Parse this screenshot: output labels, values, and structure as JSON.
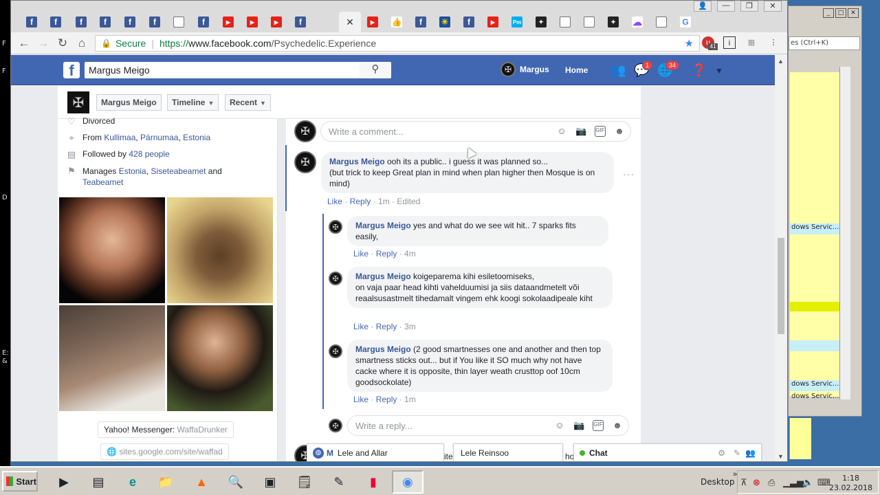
{
  "desktop": {
    "left_chars": [
      "F",
      "F",
      "D",
      "E:",
      "&"
    ]
  },
  "browser": {
    "url_secure_label": "Secure",
    "url_scheme": "https://",
    "url_host": "www.facebook.com",
    "url_path": "/Psychedelic.Experience",
    "ext_badge": "41"
  },
  "bgwin": {
    "search_placeholder": "es (Ctrl+K)",
    "rows": [
      "dows Servic...",
      "dows Servic...",
      "dows Servic..."
    ]
  },
  "fb": {
    "search_value": "Margus Meigo",
    "user_name": "Margus",
    "home_label": "Home",
    "messenger_badge": "1",
    "notif_badge": "34"
  },
  "timeline": {
    "name_btn": "Margus Meigo",
    "timeline_btn": "Timeline",
    "recent_btn": "Recent"
  },
  "intro": {
    "status": "Divorced",
    "from_prefix": "From ",
    "from_place1": "Kullimaa",
    "from_sep1": ", ",
    "from_place2": "Pärnumaa",
    "from_sep2": ", ",
    "from_place3": "Estonia",
    "followed_prefix": "Followed by ",
    "followed_link": "428 people",
    "manages_prefix": "Manages ",
    "manages_link1": "Estonia",
    "manages_sep": ", ",
    "manages_link2": "Siseteabeamet",
    "manages_and": " and",
    "manages_link3": "Teabeamet",
    "yahoo_label": "Yahoo! Messenger: ",
    "yahoo_value": "WaffaDrunker",
    "site_value": "sites.google.com/site/waffad"
  },
  "comments": {
    "write_comment_placeholder": "Write a comment...",
    "write_reply_placeholder": "Write a reply...",
    "like": "Like",
    "reply": "Reply",
    "dot": " · ",
    "main": {
      "author": "Margus Meigo",
      "text1": " ooh its a public.. i guess it was planned so...",
      "text2": "(but trick to keep Great plan in mind when plan higher then Mosque is on mind)",
      "time": "1m",
      "edited": "Edited"
    },
    "replies": [
      {
        "author": "Margus Meigo",
        "text": " yes and what do we see wit hit.. 7 sparks fits easily,",
        "time": "4m"
      },
      {
        "author": "Margus Meigo",
        "text": " koigeparema kihi esiletoomiseks,",
        "text2": "on vaja paar head kihti vahelduumisi ja siis dataandmetelt või reaalsusastmelt tihedamalt vingem ehk koogi sokolaadipeale kiht",
        "time": "3m"
      },
      {
        "author": "Margus Meigo",
        "text": " (2 good smartnesses one and another and then top smartness sticks out... but if You like it SO much why not have cacke where it is opposite, thin layer weath crusttop oof 10cm goodsockolate)",
        "time": "1m"
      }
    ]
  },
  "chat": {
    "tab1": "Lele and Allar",
    "tab2": "Lele Reinsoo",
    "frag1": "M",
    "frag2": "ite",
    "frag3": "ho",
    "chat_label": "Chat"
  },
  "taskbar": {
    "start": "Start",
    "desktop": "Desktop",
    "time": "1:18",
    "date": "23.02.2018"
  }
}
